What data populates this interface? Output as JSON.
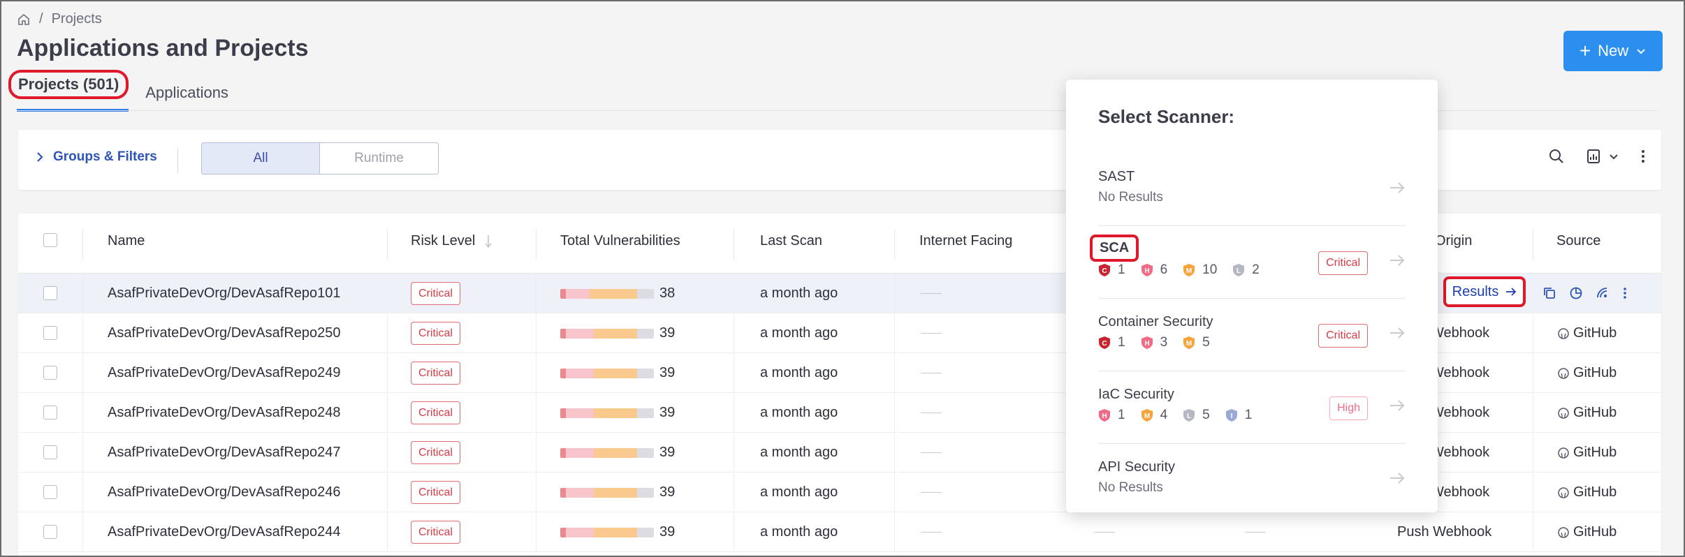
{
  "breadcrumb": {
    "separator": "/",
    "current": "Projects"
  },
  "page_title": "Applications and Projects",
  "tabs": [
    {
      "label": "Projects (501)",
      "active": true
    },
    {
      "label": "Applications",
      "active": false
    }
  ],
  "new_button": {
    "label": "New"
  },
  "filters": {
    "groups_label": "Groups & Filters",
    "segments": [
      "All",
      "Runtime"
    ],
    "selected": "All"
  },
  "table": {
    "headers": {
      "name": "Name",
      "risk": "Risk Level",
      "vulns": "Total Vulnerabilities",
      "last_scan": "Last Scan",
      "internet": "Internet Facing",
      "origin": "Origin",
      "source": "Source"
    },
    "rows": [
      {
        "name": "AsafPrivateDevOrg/DevAsafRepo101",
        "risk": "Critical",
        "vulns": "38",
        "last_scan": "a month ago",
        "origin": "",
        "source": "",
        "results": "Results"
      },
      {
        "name": "AsafPrivateDevOrg/DevAsafRepo250",
        "risk": "Critical",
        "vulns": "39",
        "last_scan": "a month ago",
        "origin": "Webhook",
        "source": "GitHub"
      },
      {
        "name": "AsafPrivateDevOrg/DevAsafRepo249",
        "risk": "Critical",
        "vulns": "39",
        "last_scan": "a month ago",
        "origin": "Webhook",
        "source": "GitHub"
      },
      {
        "name": "AsafPrivateDevOrg/DevAsafRepo248",
        "risk": "Critical",
        "vulns": "39",
        "last_scan": "a month ago",
        "origin": "Webhook",
        "source": "GitHub"
      },
      {
        "name": "AsafPrivateDevOrg/DevAsafRepo247",
        "risk": "Critical",
        "vulns": "39",
        "last_scan": "a month ago",
        "origin": "Webhook",
        "source": "GitHub"
      },
      {
        "name": "AsafPrivateDevOrg/DevAsafRepo246",
        "risk": "Critical",
        "vulns": "39",
        "last_scan": "a month ago",
        "origin": "Webhook",
        "source": "GitHub"
      },
      {
        "name": "AsafPrivateDevOrg/DevAsafRepo244",
        "risk": "Critical",
        "vulns": "39",
        "last_scan": "a month ago",
        "origin": "Push Webhook",
        "source": "GitHub"
      }
    ]
  },
  "scanner_popover": {
    "title": "Select Scanner:",
    "scanners": [
      {
        "name": "SAST",
        "sub": "No Results"
      },
      {
        "name": "SCA",
        "badge": "Critical",
        "counts": [
          {
            "sev": "C",
            "n": "1"
          },
          {
            "sev": "H",
            "n": "6"
          },
          {
            "sev": "M",
            "n": "10"
          },
          {
            "sev": "L",
            "n": "2"
          }
        ]
      },
      {
        "name": "Container Security",
        "badge": "Critical",
        "counts": [
          {
            "sev": "C",
            "n": "1"
          },
          {
            "sev": "H",
            "n": "3"
          },
          {
            "sev": "M",
            "n": "5"
          }
        ]
      },
      {
        "name": "IaC Security",
        "badge": "High",
        "counts": [
          {
            "sev": "H",
            "n": "1"
          },
          {
            "sev": "M",
            "n": "4"
          },
          {
            "sev": "L",
            "n": "5"
          },
          {
            "sev": "I",
            "n": "1"
          }
        ]
      },
      {
        "name": "API Security",
        "sub": "No Results"
      }
    ]
  },
  "colors": {
    "accent": "#2b8ff0",
    "critical": "#d93b45",
    "high": "#f06b86",
    "medium": "#f3a43a",
    "low": "#b4b8c2",
    "info": "#9aa8d6",
    "highlight": "#e0182b"
  }
}
